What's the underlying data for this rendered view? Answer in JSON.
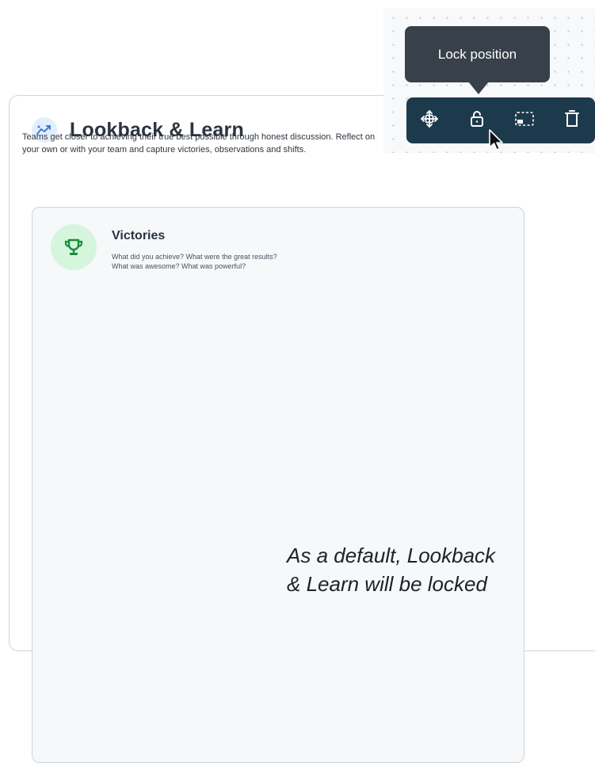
{
  "widget": {
    "title": "Lookback & Learn",
    "description": "Teams get closer to achieving their true best possible through honest discussion. Reflect on your own or with your team and capture victories, observations and shifts."
  },
  "section": {
    "title": "Victories",
    "subtitle_line1": "What did you achieve? What were the great results?",
    "subtitle_line2": "What was awesome? What was powerful?"
  },
  "tooltip": {
    "label": "Lock position"
  },
  "toolbar": {
    "buttons": [
      {
        "name": "move",
        "icon": "move-arrows-icon"
      },
      {
        "name": "lock",
        "icon": "lock-icon"
      },
      {
        "name": "select",
        "icon": "dashed-select-icon"
      },
      {
        "name": "delete",
        "icon": "trash-icon"
      }
    ]
  },
  "caption": {
    "line1": "As a default, Lookback",
    "line2": "& Learn will be locked"
  },
  "colors": {
    "toolbar_bg": "#1d3a4c",
    "tooltip_bg": "#384049",
    "victory_icon_bg": "#d6f5dd",
    "victory_icon_fg": "#178f3a",
    "title_icon_bg": "#e3eefc",
    "title_icon_fg": "#3b7be0"
  }
}
